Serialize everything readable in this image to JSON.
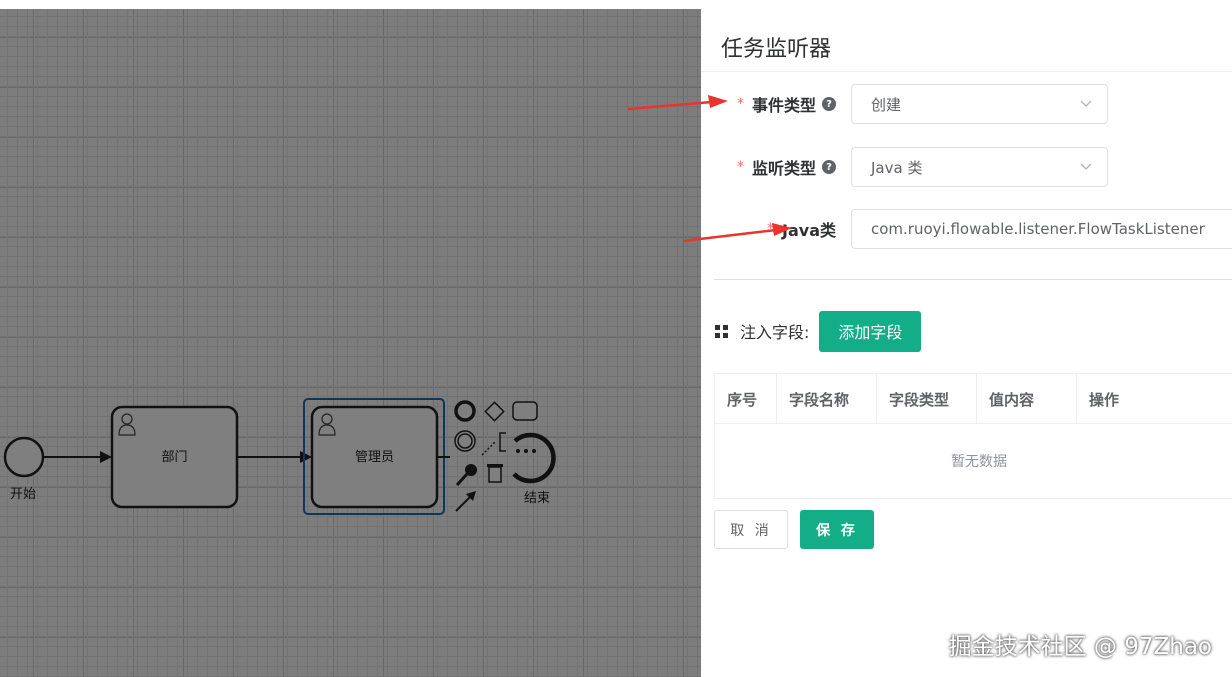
{
  "canvas": {
    "nodes": {
      "start_label": "开始",
      "task1_label": "部门",
      "task2_label": "管理员",
      "end_label": "结束"
    }
  },
  "drawer": {
    "title": "任务监听器",
    "fields": {
      "event_type": {
        "label": "事件类型",
        "value": "创建"
      },
      "listener_type": {
        "label": "监听类型",
        "value": "Java 类"
      },
      "java_class": {
        "label": "Java类",
        "value": "com.ruoyi.flowable.listener.FlowTaskListener"
      }
    },
    "inject": {
      "label": "注入字段:",
      "add_button": "添加字段"
    },
    "table": {
      "columns": [
        "序号",
        "字段名称",
        "字段类型",
        "值内容",
        "操作"
      ],
      "empty_text": "暂无数据"
    },
    "actions": {
      "cancel": "取 消",
      "save": "保 存"
    }
  },
  "watermark": "掘金技术社区 @ 97Zhao",
  "colors": {
    "primary": "#13ae88",
    "required": "#f56c6c",
    "selection": "#1c6cb4",
    "annotation_arrow": "#e8342b"
  }
}
